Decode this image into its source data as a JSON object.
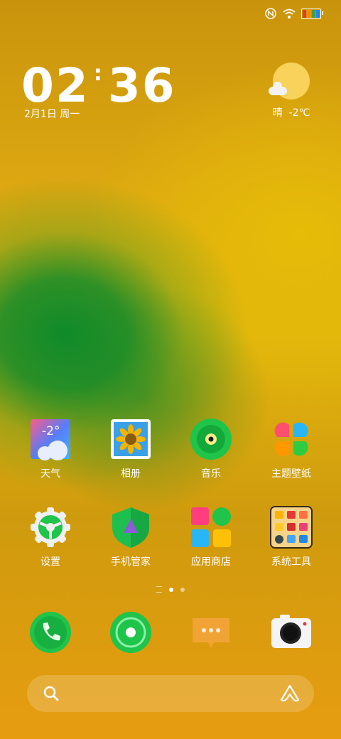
{
  "status_bar": {
    "icons": [
      "nfc-icon",
      "wifi-icon",
      "battery-icon"
    ]
  },
  "clock": {
    "hour": "02",
    "separator": ":",
    "minute": "36",
    "date": "2月1日 周一"
  },
  "weather_widget": {
    "condition": "晴",
    "temperature": "-2℃",
    "icon": "sunny-cloudy-icon"
  },
  "apps": [
    {
      "label": "天气",
      "icon": "weather-app-icon",
      "badge_text": "-2°"
    },
    {
      "label": "相册",
      "icon": "gallery-icon"
    },
    {
      "label": "音乐",
      "icon": "music-icon"
    },
    {
      "label": "主题壁纸",
      "icon": "theme-icon"
    },
    {
      "label": "设置",
      "icon": "settings-gear-icon"
    },
    {
      "label": "手机管家",
      "icon": "phone-manager-shield-icon"
    },
    {
      "label": "应用商店",
      "icon": "app-store-icon"
    },
    {
      "label": "系统工具",
      "icon": "system-tools-folder-icon"
    }
  ],
  "page_indicator": {
    "pages": 2,
    "current": 1
  },
  "dock": [
    {
      "name": "phone",
      "icon": "phone-icon"
    },
    {
      "name": "browser",
      "icon": "browser-icon"
    },
    {
      "name": "messages",
      "icon": "messages-icon"
    },
    {
      "name": "camera",
      "icon": "camera-icon"
    }
  ],
  "search_bar": {
    "left_icon": "search-icon",
    "right_icon": "assistant-icon"
  },
  "colors": {
    "accent_green": "#1fc44a",
    "wallpaper_yellow": "#e2b50d",
    "wallpaper_green": "#0f8a2a"
  }
}
